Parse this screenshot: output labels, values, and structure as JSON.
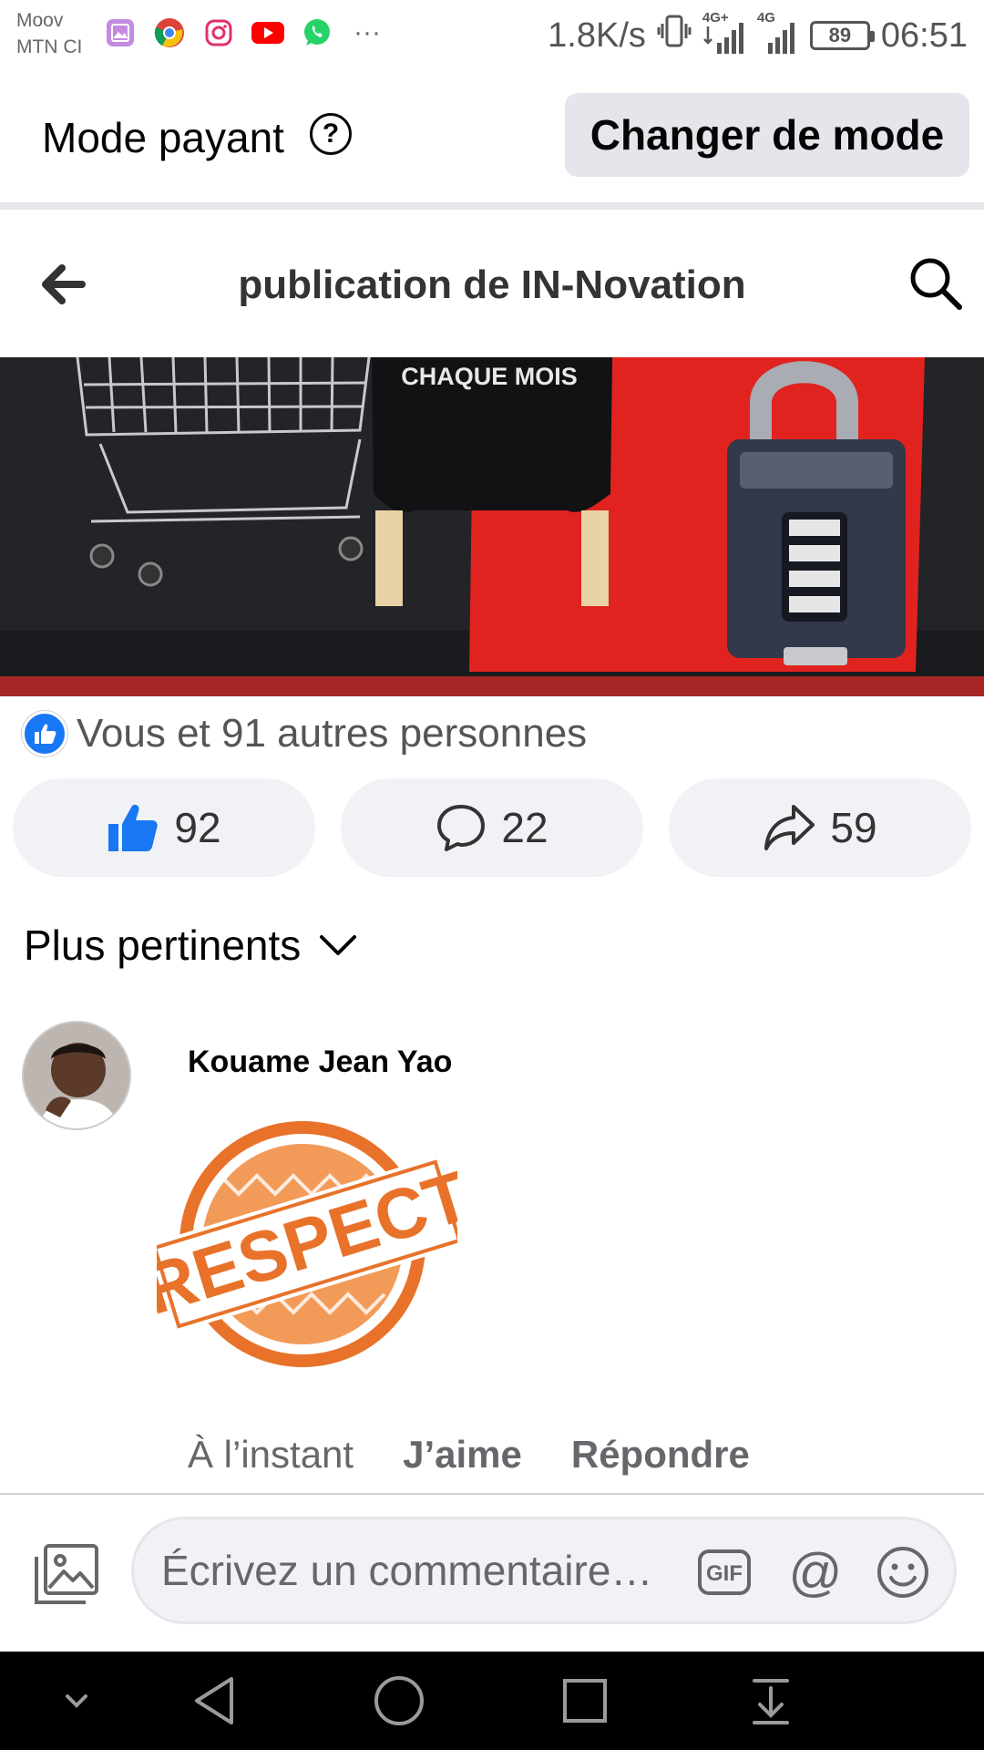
{
  "status_bar": {
    "carrier_1": "Moov",
    "carrier_2": "MTN CI",
    "network_speed": "1.8K/s",
    "signal_1_type": "4G+",
    "signal_2_type": "4G",
    "battery": "89",
    "time": "06:51",
    "apps": [
      "gallery-icon",
      "chrome-icon",
      "instagram-icon",
      "youtube-icon",
      "whatsapp-icon"
    ],
    "more": "···"
  },
  "mode_bar": {
    "label": "Mode payant",
    "help": "?",
    "button": "Changer de mode"
  },
  "header": {
    "title": "publication de IN-Novation"
  },
  "post": {
    "image_text": "CHAQUE MOIS",
    "reactions_summary": "Vous et 91 autres personnes",
    "likes": "92",
    "comments": "22",
    "shares": "59"
  },
  "sort": {
    "label": "Plus pertinents"
  },
  "comment": {
    "author": "Kouame Jean Yao",
    "sticker_text": "RESPECT",
    "time": "À l’instant",
    "like_label": "J’aime",
    "reply_label": "Répondre"
  },
  "composer": {
    "placeholder": "Écrivez un commentaire…",
    "gif_label": "GIF",
    "mention_label": "@"
  },
  "colors": {
    "facebook_blue": "#1877f2",
    "button_gray": "#e4e6eb",
    "pill_gray": "#f0f2f5",
    "sticker_orange": "#e8722a"
  }
}
